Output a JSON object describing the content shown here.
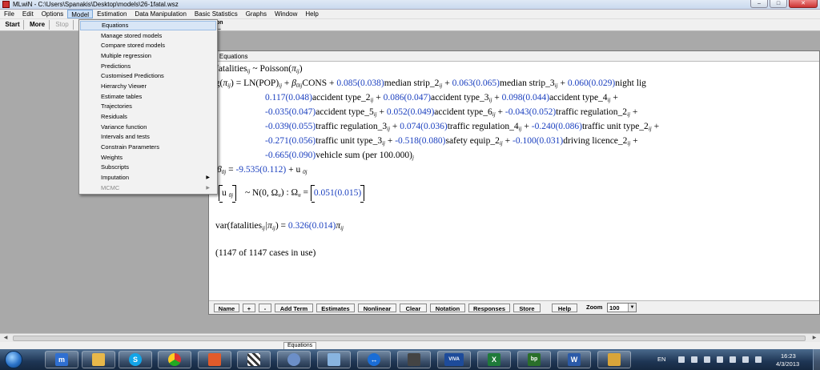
{
  "window": {
    "title": "MLwiN - C:\\Users\\Spanakis\\Desktop\\models\\26-1fatal.wsz"
  },
  "menubar": [
    "File",
    "Edit",
    "Options",
    "Model",
    "Estimation",
    "Data Manipulation",
    "Basic Statistics",
    "Graphs",
    "Window",
    "Help"
  ],
  "toolbar": {
    "start": "Start",
    "more": "More",
    "stop": "Stop",
    "partial_line1": "on",
    "partial_line2": "..."
  },
  "model_menu": {
    "items": [
      "Equations",
      "Manage stored models",
      "Compare stored models",
      "Multiple regression",
      "Predictions",
      "Customised Predictions",
      "Hierarchy Viewer",
      "Estimate tables",
      "Trajectories",
      "Residuals",
      "Variance function",
      "Intervals and tests",
      "Constrain Parameters",
      "Weights",
      "Subscripts",
      "Imputation",
      "MCMC"
    ],
    "highlighted": "Equations",
    "disabled": [
      "MCMC"
    ],
    "submenu": [
      "Imputation",
      "MCMC"
    ]
  },
  "equations_window": {
    "title": "- Equations",
    "line1": {
      "lhs": "fatalities",
      "sub": "ij",
      "mid": " ~ Poisson(",
      "pi": "π",
      "pisub": "ij",
      "close": ")"
    },
    "line2": {
      "log": "og(",
      "pi": "π",
      "pisub": "ij",
      "eq": ") = LN(POP)",
      "offsub": "ij",
      "plus1": " + ",
      "beta": "β",
      "betasub": "0ij",
      "cons": "CONS + ",
      "c1": "0.085(0.038)",
      "t1": "median strip_2",
      "s1": "ij",
      "p1": " + ",
      "c2": "0.063(0.065)",
      "t2": "median strip_3",
      "s2": "ij",
      "p2": " + ",
      "c3": "0.060(0.029)",
      "t3": "night lig"
    },
    "line3": {
      "c1": "0.117(0.048)",
      "t1": "accident type_2",
      "s1": "ij",
      "p1": " + ",
      "c2": "0.086(0.047)",
      "t2": "accident type_3",
      "s2": "ij",
      "p2": " + ",
      "c3": "0.098(0.044)",
      "t3": "accident type_4",
      "s3": "ij",
      "p3": " +"
    },
    "line4": {
      "c1": "-0.035(0.047)",
      "t1": "accident type_5",
      "s1": "ij",
      "p1": " + ",
      "c2": "0.052(0.049)",
      "t2": "accident type_6",
      "s2": "ij",
      "p2": " + ",
      "c3": "-0.043(0.052)",
      "t3": "traffic regulation_2",
      "s3": "ij",
      "p3": " +"
    },
    "line5": {
      "c1": "-0.039(0.055)",
      "t1": "traffic regulation_3",
      "s1": "ij",
      "p1": " + ",
      "c2": "0.074(0.036)",
      "t2": "traffic regulation_4",
      "s2": "ij",
      "p2": " + ",
      "c3": "-0.240(0.086)",
      "t3": "traffic unit type_2",
      "s3": "ij",
      "p3": " +"
    },
    "line6": {
      "c1": "-0.271(0.056)",
      "t1": "traffic unit type_3",
      "s1": "ij",
      "p1": " + ",
      "c2": "-0.518(0.080)",
      "t2": "safety equip_2",
      "s2": "ij",
      "p2": " + ",
      "c3": "-0.100(0.031)",
      "t3": "driving licence_2",
      "s3": "ij",
      "p3": " +"
    },
    "line7": {
      "c1": "-0.665(0.090)",
      "t1": "vehicle sum (per 100.000)",
      "s1": "j"
    },
    "line8": {
      "beta": "β",
      "betasub": "0j",
      "eq": " = ",
      "val": "-9.535(0.112)",
      "rest": " + u ",
      "usub": "0j"
    },
    "line9": {
      "u": "u ",
      "usub": "0j",
      "dist": "~ N(0,  Ω",
      "omsub": "u",
      "mid": ")  :  Ω",
      "omsub2": "u",
      "eq": " = ",
      "val": "0.051(0.015)"
    },
    "line10": {
      "lhs": "var(fatalities",
      "sub": "ij",
      "bar": "|π",
      "pisub": "ij",
      "eq": ") = ",
      "val": "0.326(0.014)",
      "pi": "π",
      "pisub2": "ij"
    },
    "line11": "(1147 of 1147 cases in use)",
    "buttons": [
      "Name",
      "+",
      "-",
      "Add Term",
      "Estimates",
      "Nonlinear",
      "Clear",
      "Notation",
      "Responses",
      "Store",
      "Help"
    ],
    "zoom_label": "Zoom",
    "zoom_value": "100"
  },
  "statusbar": {
    "tab": "Equations"
  },
  "taskbar": {
    "apps": [
      "mlwin",
      "explorer",
      "skype",
      "chrome",
      "app",
      "calc",
      "paint",
      "notes",
      "teamviewer",
      "viva",
      "excel",
      "bp",
      "word",
      "pen"
    ],
    "lang": "EN",
    "time": "16:23",
    "date": "4/3/2013"
  }
}
